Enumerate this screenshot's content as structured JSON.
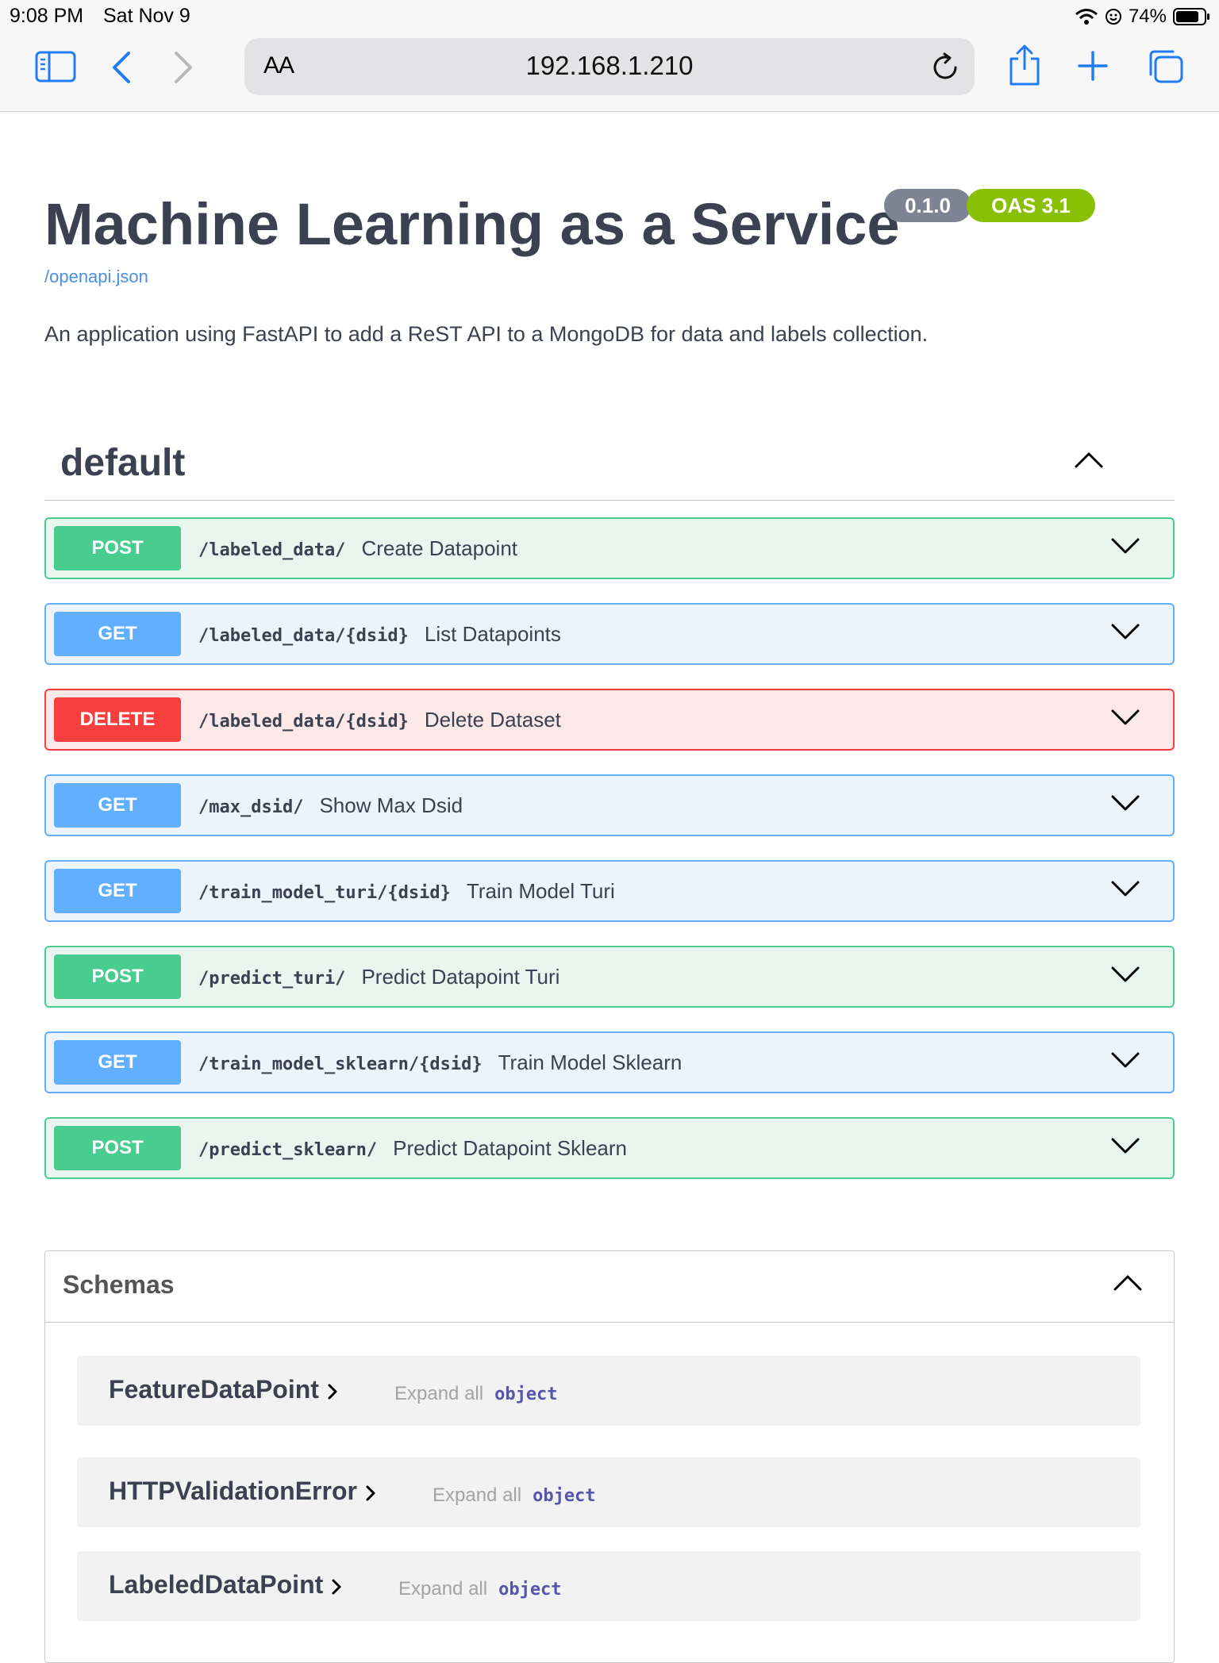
{
  "status_bar": {
    "time": "9:08 PM",
    "date": "Sat Nov 9",
    "battery": "74%"
  },
  "browser": {
    "text_size_label": "AA",
    "url": "192.168.1.210",
    "icons": [
      "sidebar-icon",
      "back-icon",
      "forward-icon",
      "reload-icon",
      "share-icon",
      "new-tab-icon",
      "tabs-icon"
    ]
  },
  "api": {
    "title": "Machine Learning as a Service",
    "version": "0.1.0",
    "oas": "OAS 3.1",
    "spec_link": "/openapi.json",
    "description": "An application using FastAPI to add a ReST API to a MongoDB for data and labels collection."
  },
  "tag": {
    "name": "default"
  },
  "operations": [
    {
      "method": "POST",
      "path": "/labeled_data/",
      "summary": "Create Datapoint"
    },
    {
      "method": "GET",
      "path": "/labeled_data/{dsid}",
      "summary": "List Datapoints"
    },
    {
      "method": "DELETE",
      "path": "/labeled_data/{dsid}",
      "summary": "Delete Dataset"
    },
    {
      "method": "GET",
      "path": "/max_dsid/",
      "summary": "Show Max Dsid"
    },
    {
      "method": "GET",
      "path": "/train_model_turi/{dsid}",
      "summary": "Train Model Turi"
    },
    {
      "method": "POST",
      "path": "/predict_turi/",
      "summary": "Predict Datapoint Turi"
    },
    {
      "method": "GET",
      "path": "/train_model_sklearn/{dsid}",
      "summary": "Train Model Sklearn"
    },
    {
      "method": "POST",
      "path": "/predict_sklearn/",
      "summary": "Predict Datapoint Sklearn"
    }
  ],
  "schemas": {
    "title": "Schemas",
    "models": [
      {
        "name": "FeatureDataPoint",
        "expand_label": "Expand all",
        "type": "object"
      },
      {
        "name": "HTTPValidationError",
        "expand_label": "Expand all",
        "type": "object"
      },
      {
        "name": "LabeledDataPoint",
        "expand_label": "Expand all",
        "type": "object"
      }
    ]
  },
  "colors": {
    "post": "#49cc90",
    "get": "#61affe",
    "delete": "#f93e3e",
    "oas_badge": "#89bf04",
    "version_badge": "#7d8492"
  }
}
